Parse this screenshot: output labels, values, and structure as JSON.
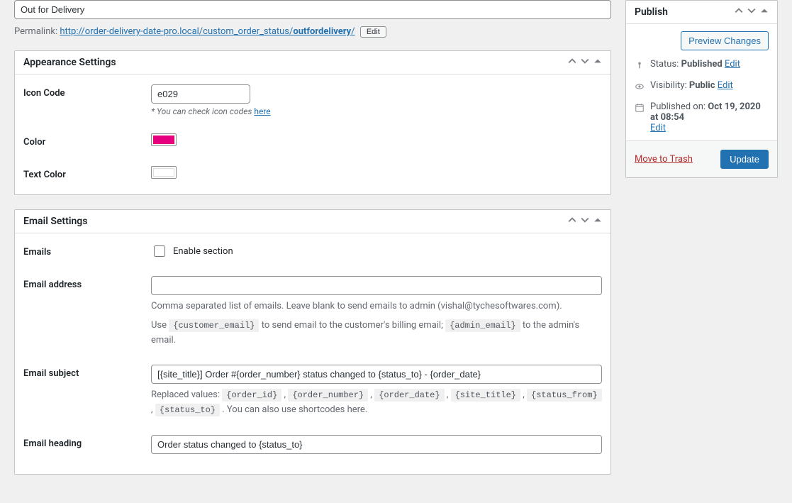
{
  "title": "Out for Delivery",
  "permalink": {
    "label": "Permalink:",
    "base": "http://order-delivery-date-pro.local/custom_order_status/",
    "slug": "outfordelivery",
    "edit_label": "Edit"
  },
  "appearance": {
    "heading": "Appearance Settings",
    "icon_code": {
      "label": "Icon Code",
      "value": "e029",
      "hint_prefix": "* You can check icon codes ",
      "hint_link": "here"
    },
    "color": {
      "label": "Color",
      "value": "#e6007e"
    },
    "text_color": {
      "label": "Text Color",
      "value": "#ffffff"
    }
  },
  "email": {
    "heading": "Email Settings",
    "enable": {
      "label": "Emails",
      "checkbox_label": "Enable section",
      "checked": false
    },
    "address": {
      "label": "Email address",
      "value": "",
      "desc1": "Comma separated list of emails. Leave blank to send emails to admin (vishal@tychesoftwares.com).",
      "desc2_pre": "Use ",
      "desc2_code1": "{customer_email}",
      "desc2_mid": " to send email to the customer's billing email; ",
      "desc2_code2": "{admin_email}",
      "desc2_post": " to the admin's email."
    },
    "subject": {
      "label": "Email subject",
      "value": "[{site_title}] Order #{order_number} status changed to {status_to} - {order_date}",
      "desc_pre": "Replaced values: ",
      "codes": [
        "{order_id}",
        "{order_number}",
        "{order_date}",
        "{site_title}",
        "{status_from}",
        "{status_to}"
      ],
      "desc_post": " . You can also use shortcodes here."
    },
    "heading_field": {
      "label": "Email heading",
      "value": "Order status changed to {status_to}"
    }
  },
  "publish": {
    "heading": "Publish",
    "preview_label": "Preview Changes",
    "status": {
      "label": "Status:",
      "value": "Published",
      "edit": "Edit"
    },
    "visibility": {
      "label": "Visibility:",
      "value": "Public",
      "edit": "Edit"
    },
    "date": {
      "label": "Published on:",
      "value": "Oct 19, 2020 at 08:54",
      "edit": "Edit"
    },
    "trash": "Move to Trash",
    "update": "Update"
  }
}
